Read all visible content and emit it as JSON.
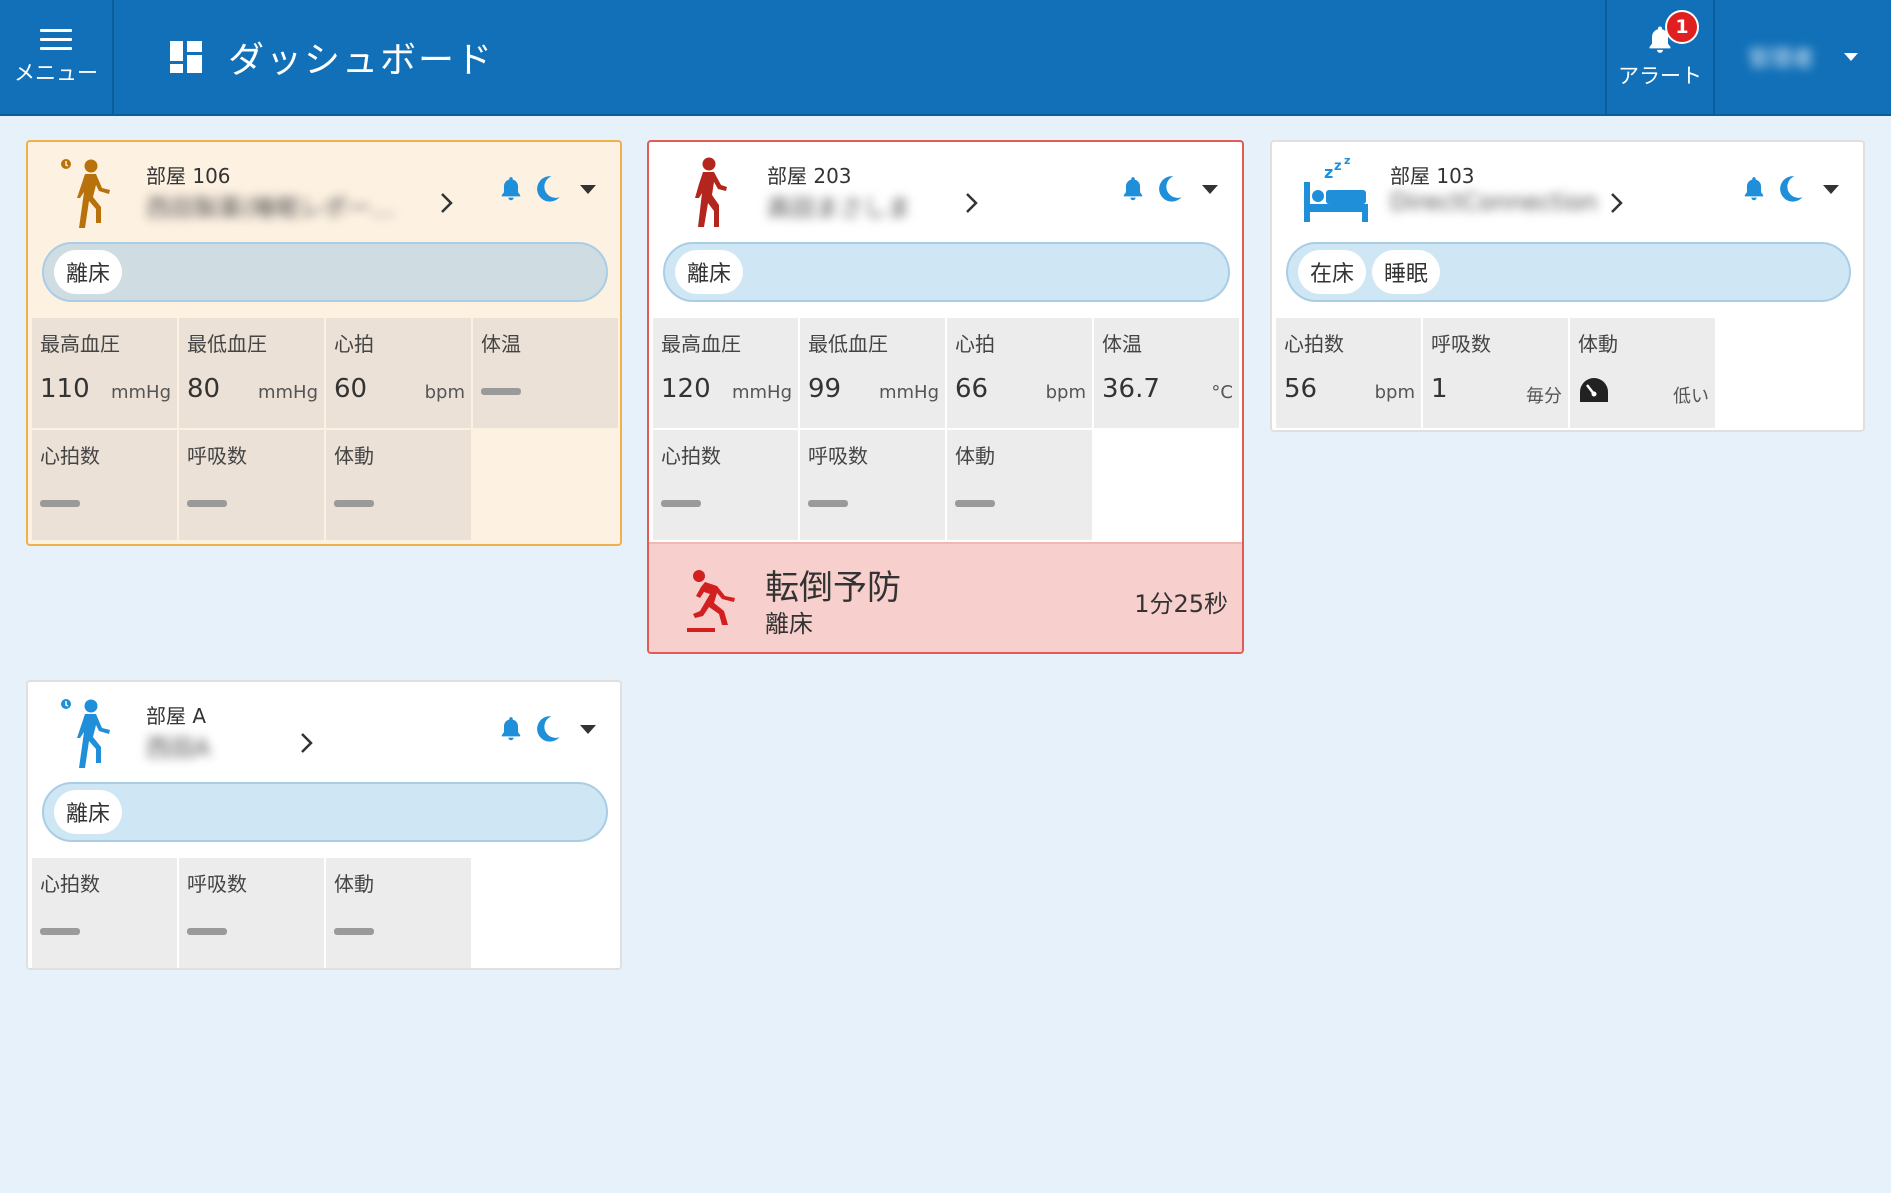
{
  "header": {
    "menu_label": "メニュー",
    "title": "ダッシュボード",
    "alert_label": "アラート",
    "alert_count": "1",
    "user_name": "管理者"
  },
  "colors": {
    "header": "#1170b8",
    "warn_border": "#f0b14c",
    "danger_border": "#e35b56",
    "icon_blue": "#1e8fd8",
    "icon_orange": "#b8720c",
    "icon_red": "#b3261e"
  },
  "cards": [
    {
      "room": "部屋 106",
      "name": "西田製薬(睡眠レポー...",
      "status": [
        "離床"
      ],
      "metrics": [
        {
          "label": "最高血圧",
          "value": "110",
          "unit": "mmHg"
        },
        {
          "label": "最低血圧",
          "value": "80",
          "unit": "mmHg"
        },
        {
          "label": "心拍",
          "value": "60",
          "unit": "bpm"
        },
        {
          "label": "体温",
          "value": "",
          "unit": ""
        },
        {
          "label": "心拍数",
          "value": "",
          "unit": ""
        },
        {
          "label": "呼吸数",
          "value": "",
          "unit": ""
        },
        {
          "label": "体動",
          "value": "",
          "unit": ""
        }
      ]
    },
    {
      "room": "部屋 203",
      "name": "高田まさしま",
      "status": [
        "離床"
      ],
      "metrics": [
        {
          "label": "最高血圧",
          "value": "120",
          "unit": "mmHg"
        },
        {
          "label": "最低血圧",
          "value": "99",
          "unit": "mmHg"
        },
        {
          "label": "心拍",
          "value": "66",
          "unit": "bpm"
        },
        {
          "label": "体温",
          "value": "36.7",
          "unit": "°C"
        },
        {
          "label": "心拍数",
          "value": "",
          "unit": ""
        },
        {
          "label": "呼吸数",
          "value": "",
          "unit": ""
        },
        {
          "label": "体動",
          "value": "",
          "unit": ""
        }
      ],
      "alert": {
        "type": "転倒予防",
        "sub": "離床",
        "time": "1分25秒"
      }
    },
    {
      "room": "部屋 103",
      "name": "DirectConnection",
      "status": [
        "在床",
        "睡眠"
      ],
      "metrics": [
        {
          "label": "心拍数",
          "value": "56",
          "unit": "bpm"
        },
        {
          "label": "呼吸数",
          "value": "1",
          "unit": "毎分"
        },
        {
          "label": "体動",
          "value": "",
          "unit": "低い"
        }
      ]
    },
    {
      "room": "部屋 A",
      "name": "西田A",
      "status": [
        "離床"
      ],
      "metrics": [
        {
          "label": "心拍数",
          "value": "",
          "unit": ""
        },
        {
          "label": "呼吸数",
          "value": "",
          "unit": ""
        },
        {
          "label": "体動",
          "value": "",
          "unit": ""
        }
      ]
    }
  ]
}
